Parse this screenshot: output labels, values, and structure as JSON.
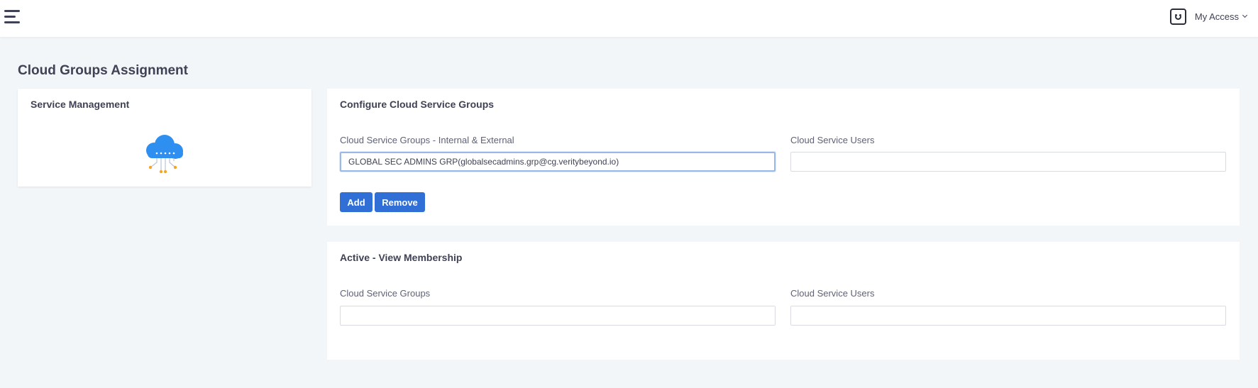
{
  "header": {
    "menu_icon": "hamburger-menu-icon",
    "avatar_icon": "smiley-face-icon",
    "user_menu_label": "My Access",
    "user_menu_chevron": "chevron-down-icon"
  },
  "page": {
    "title": "Cloud Groups Assignment"
  },
  "service_management": {
    "title": "Service Management",
    "icon": "cloud-network-icon"
  },
  "configure": {
    "title": "Configure Cloud Service Groups",
    "groups_label": "Cloud Service Groups - Internal & External",
    "groups_value": "GLOBAL SEC ADMINS GRP(globalsecadmins.grp@cg.veritybeyond.io)",
    "users_label": "Cloud Service Users",
    "users_value": "",
    "add_label": "Add",
    "remove_label": "Remove"
  },
  "active": {
    "title": "Active - View Membership",
    "groups_label": "Cloud Service Groups",
    "groups_value": "",
    "users_label": "Cloud Service Users",
    "users_value": ""
  },
  "colors": {
    "accent": "#2f6fd6",
    "background": "#f3f6f9",
    "cloud": "#2e8ff0",
    "cloud_nodes": "#f5a623"
  }
}
